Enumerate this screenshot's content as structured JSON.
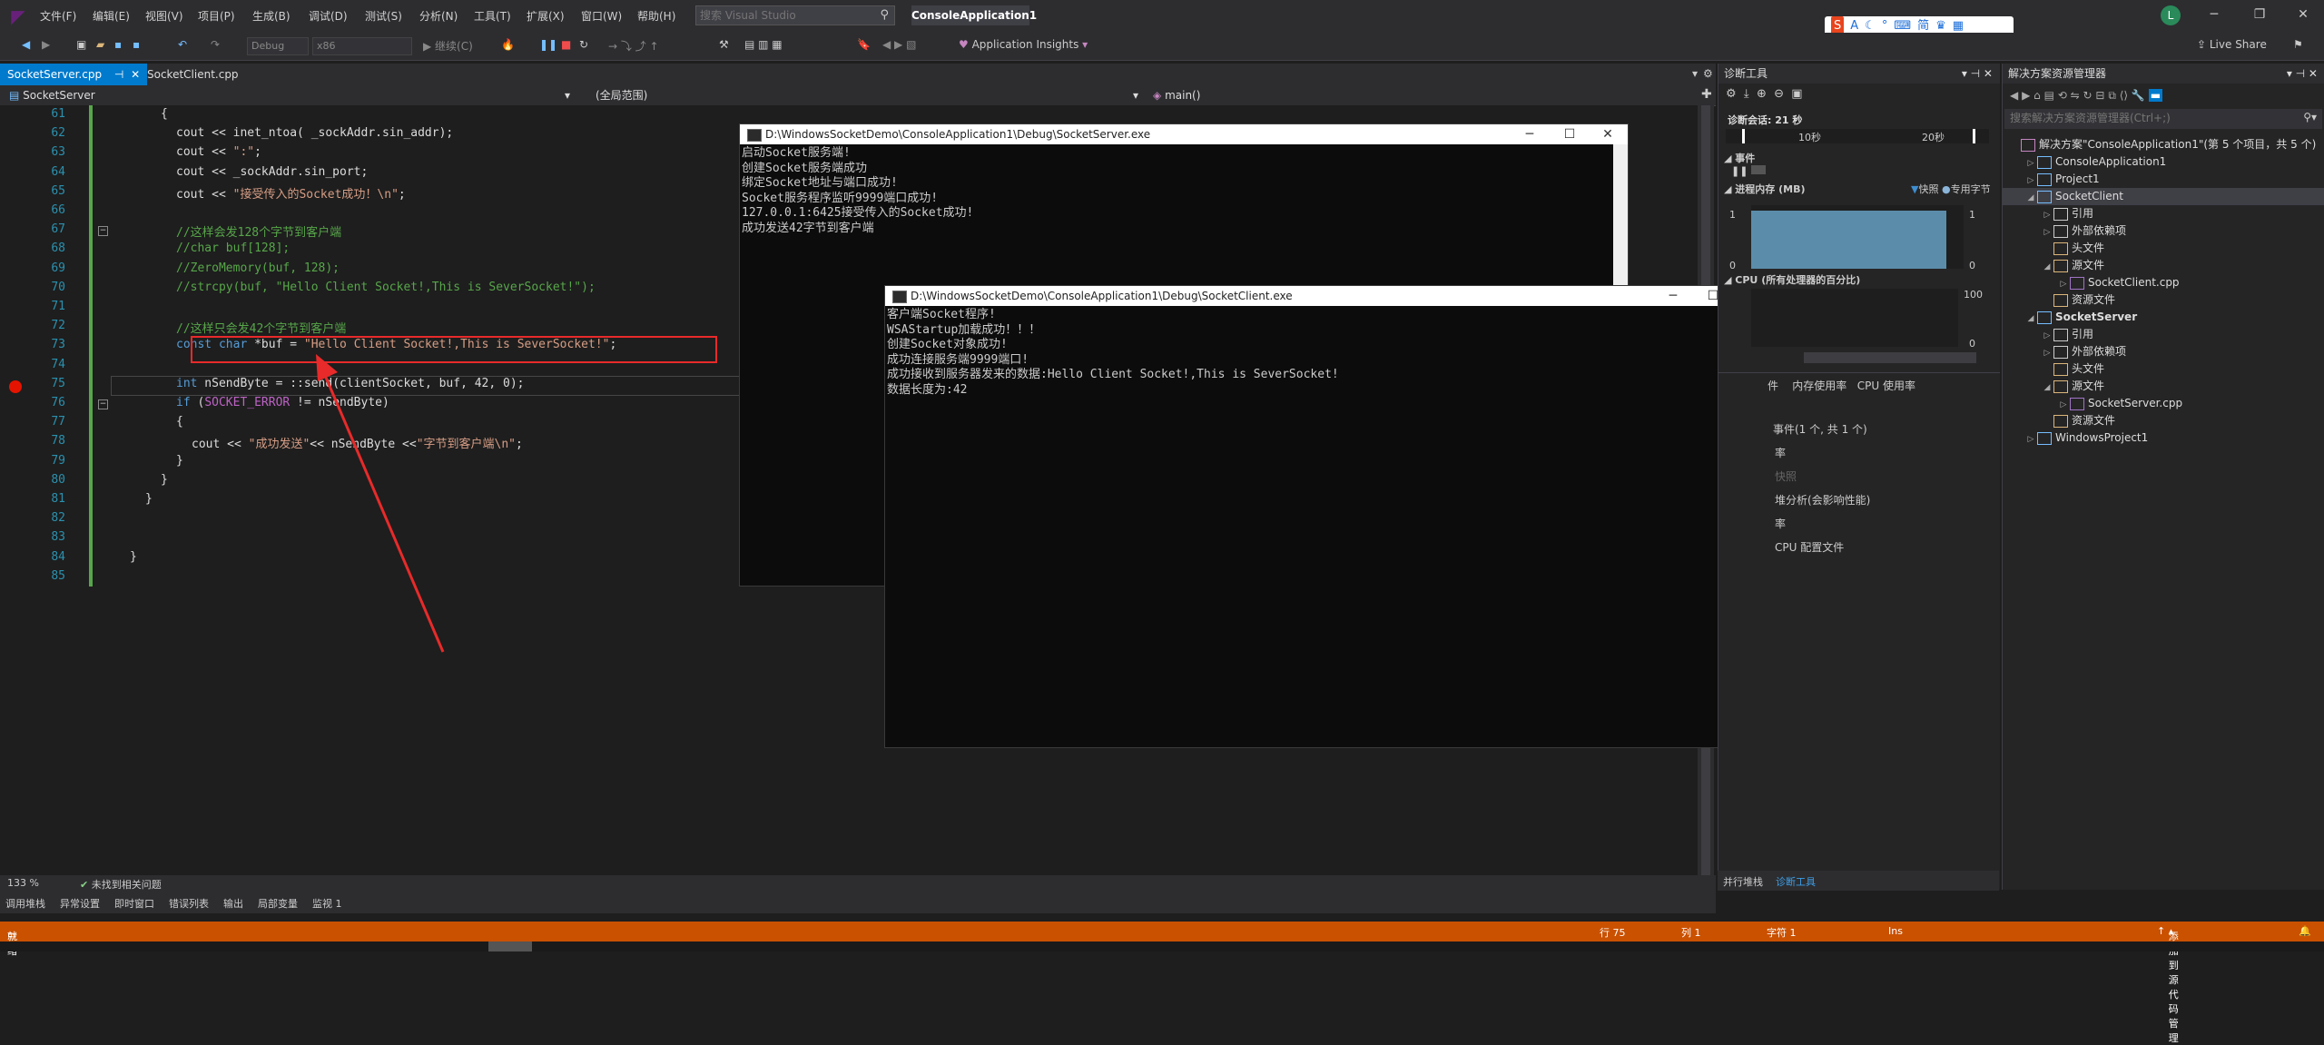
{
  "menubar": {
    "items": [
      "文件(F)",
      "编辑(E)",
      "视图(V)",
      "项目(P)",
      "生成(B)",
      "调试(D)",
      "测试(S)",
      "分析(N)",
      "工具(T)",
      "扩展(X)",
      "窗口(W)",
      "帮助(H)"
    ],
    "search_placeholder": "搜索 Visual Studio",
    "solution_name": "ConsoleApplication1",
    "avatar_letter": "L",
    "live_share": "Live Share"
  },
  "toolbar": {
    "config": "Debug",
    "platform": "x86",
    "continue": "继续(C)",
    "app_insights": "Application Insights"
  },
  "tabs": {
    "active": "SocketServer.cpp",
    "second": "SocketClient.cpp"
  },
  "navbar": {
    "project": "SocketServer",
    "scope": "(全局范围)",
    "member": "main()"
  },
  "editor": {
    "line_numbers": [
      "61",
      "62",
      "63",
      "64",
      "65",
      "66",
      "67",
      "68",
      "69",
      "70",
      "71",
      "72",
      "73",
      "74",
      "75",
      "76",
      "77",
      "78",
      "79",
      "80",
      "81",
      "82",
      "83",
      "84",
      "85"
    ],
    "lines": [
      {
        "segments": [
          {
            "t": "{",
            "c": ""
          }
        ]
      },
      {
        "segments": [
          {
            "t": "cout << inet_ntoa( _sockAddr.sin_addr);",
            "c": ""
          }
        ]
      },
      {
        "segments": [
          {
            "t": "cout << ",
            "c": ""
          },
          {
            "t": "\":\"",
            "c": "str"
          },
          {
            "t": ";",
            "c": ""
          }
        ]
      },
      {
        "segments": [
          {
            "t": "cout << _sockAddr.sin_port;",
            "c": ""
          }
        ]
      },
      {
        "segments": [
          {
            "t": "cout << ",
            "c": ""
          },
          {
            "t": "\"接受传入的Socket成功！\\n\"",
            "c": "str"
          },
          {
            "t": ";",
            "c": ""
          }
        ]
      },
      {
        "segments": []
      },
      {
        "segments": [
          {
            "t": "//这样会发128个字节到客户端",
            "c": "cm"
          }
        ]
      },
      {
        "segments": [
          {
            "t": "//char buf[128];",
            "c": "cm"
          }
        ]
      },
      {
        "segments": [
          {
            "t": "//ZeroMemory(buf, 128);",
            "c": "cm"
          }
        ]
      },
      {
        "segments": [
          {
            "t": "//strcpy(buf, \"Hello Client Socket!,This is SeverSocket!\");",
            "c": "cm"
          }
        ]
      },
      {
        "segments": []
      },
      {
        "segments": [
          {
            "t": "//这样只会发42个字节到客户端",
            "c": "cm"
          }
        ]
      },
      {
        "segments": [
          {
            "t": "const char",
            "c": "kw"
          },
          {
            "t": " *buf = ",
            "c": ""
          },
          {
            "t": "\"Hello Client Socket!,This is SeverSocket!\"",
            "c": "str"
          },
          {
            "t": ";",
            "c": ""
          }
        ]
      },
      {
        "segments": []
      },
      {
        "segments": [
          {
            "t": "int",
            "c": "kw"
          },
          {
            "t": " nSendByte = ::send(clientSocket, buf, 42, 0);",
            "c": ""
          }
        ]
      },
      {
        "segments": [
          {
            "t": "if",
            "c": "kw"
          },
          {
            "t": " (",
            "c": ""
          },
          {
            "t": "SOCKET_ERROR",
            "c": "macro"
          },
          {
            "t": " != nSendByte)",
            "c": ""
          }
        ]
      },
      {
        "segments": [
          {
            "t": "{",
            "c": ""
          }
        ]
      },
      {
        "segments": [
          {
            "t": "cout << ",
            "c": ""
          },
          {
            "t": "\"成功发送\"",
            "c": "str"
          },
          {
            "t": "<< nSendByte <<",
            "c": ""
          },
          {
            "t": "\"字节到客户端\\n\"",
            "c": "str"
          },
          {
            "t": ";",
            "c": ""
          }
        ]
      },
      {
        "segments": [
          {
            "t": "}",
            "c": ""
          }
        ]
      },
      {
        "segments": [
          {
            "t": "}",
            "c": ""
          }
        ]
      },
      {
        "segments": [
          {
            "t": "}",
            "c": ""
          }
        ]
      },
      {
        "segments": []
      },
      {
        "segments": []
      },
      {
        "segments": [
          {
            "t": "}",
            "c": ""
          }
        ]
      },
      {
        "segments": []
      }
    ],
    "zoom": "133 %",
    "issues": "未找到相关问题"
  },
  "server_console": {
    "title": "D:\\WindowsSocketDemo\\ConsoleApplication1\\Debug\\SocketServer.exe",
    "text": "启动Socket服务端!\n创建Socket服务端成功\n绑定Socket地址与端口成功!\nSocket服务程序监听9999端口成功!\n127.0.0.1:6425接受传入的Socket成功!\n成功发送42字节到客户端"
  },
  "client_console": {
    "title": "D:\\WindowsSocketDemo\\ConsoleApplication1\\Debug\\SocketClient.exe",
    "text": "客户端Socket程序!\nWSAStartup加载成功！！！\n创建Socket对象成功!\n成功连接服务端9999端口!\n成功接收到服务器发来的数据:Hello Client Socket!,This is SeverSocket!\n数据长度为:42"
  },
  "diagnostics": {
    "title": "诊断工具",
    "session": "诊断会话: 21 秒",
    "t10": "10秒",
    "t20": "20秒",
    "events": "事件",
    "memory": "进程内存 (MB)",
    "snapshot": "快照",
    "private_bytes": "专用字节",
    "mem_max": "1",
    "mem_min": "0",
    "cpu": "CPU (所有处理器的百分比)",
    "cpu_max": "100",
    "cpu_min": "0",
    "tab_mem": "内存使用率",
    "tab_cpu": "CPU 使用率",
    "tab_events": "件",
    "events_count": "事件(1 个, 共 1 个)",
    "rate1": "率",
    "snapshot_link": "快照",
    "heap": "堆分析(会影响性能)",
    "rate2": "率",
    "cpu_profile": "CPU 配置文件",
    "memory_fill": 0.92
  },
  "solution": {
    "title": "解决方案资源管理器",
    "search_placeholder": "搜索解决方案资源管理器(Ctrl+;)",
    "items": [
      {
        "label": "解决方案\"ConsoleApplication1\"(第 5 个项目，共 5 个)",
        "indent": 0,
        "tri": "",
        "bold": false
      },
      {
        "label": "ConsoleApplication1",
        "indent": 1,
        "tri": "▷",
        "bold": false
      },
      {
        "label": "Project1",
        "indent": 1,
        "tri": "▷",
        "bold": false
      },
      {
        "label": "SocketClient",
        "indent": 1,
        "tri": "◢",
        "bold": false
      },
      {
        "label": "引用",
        "indent": 2,
        "tri": "▷",
        "bold": false
      },
      {
        "label": "外部依赖项",
        "indent": 2,
        "tri": "▷",
        "bold": false
      },
      {
        "label": "头文件",
        "indent": 2,
        "tri": "",
        "bold": false
      },
      {
        "label": "源文件",
        "indent": 2,
        "tri": "◢",
        "bold": false
      },
      {
        "label": "SocketClient.cpp",
        "indent": 3,
        "tri": "▷",
        "bold": false
      },
      {
        "label": "资源文件",
        "indent": 2,
        "tri": "",
        "bold": false
      },
      {
        "label": "SocketServer",
        "indent": 1,
        "tri": "◢",
        "bold": true
      },
      {
        "label": "引用",
        "indent": 2,
        "tri": "▷",
        "bold": false
      },
      {
        "label": "外部依赖项",
        "indent": 2,
        "tri": "▷",
        "bold": false
      },
      {
        "label": "头文件",
        "indent": 2,
        "tri": "",
        "bold": false
      },
      {
        "label": "源文件",
        "indent": 2,
        "tri": "◢",
        "bold": false
      },
      {
        "label": "SocketServer.cpp",
        "indent": 3,
        "tri": "▷",
        "bold": false
      },
      {
        "label": "资源文件",
        "indent": 2,
        "tri": "",
        "bold": false
      },
      {
        "label": "WindowsProject1",
        "indent": 1,
        "tri": "▷",
        "bold": false
      }
    ]
  },
  "bottom_tabs": [
    "调用堆栈",
    "异常设置",
    "即时窗口",
    "错误列表",
    "输出",
    "局部变量",
    "监视 1"
  ],
  "right_bottom_tabs": [
    "并行堆栈",
    "诊断工具"
  ],
  "statusbar": {
    "ready": "就绪",
    "line": "行 75",
    "col": "列 1",
    "char": "字符 1",
    "ins": "Ins",
    "source_control": "添加到源代码管理"
  },
  "colors": {
    "status": "#ca5100",
    "accent": "#007acc",
    "highlight_box": "#e82a2a"
  }
}
